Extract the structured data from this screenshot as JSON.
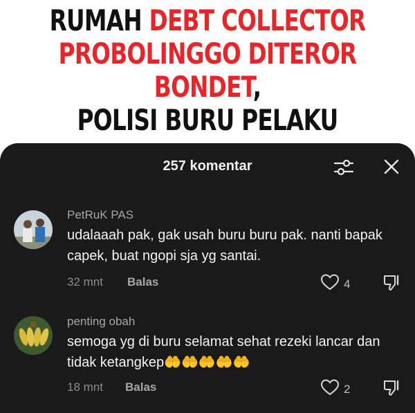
{
  "headline": {
    "line1_black": "RUMAH ",
    "line1_red": "DEBT COLLECTOR",
    "line2_red": "PROBOLINGGO DITEROR BONDET",
    "line2_black": ",",
    "line3_black": "POLISI BURU PELAKU"
  },
  "sheet": {
    "title": "257 komentar",
    "filter_icon": "filter-sliders-icon",
    "close_icon": "close-icon"
  },
  "comments": [
    {
      "username": "PetRuK PAS",
      "text": "udalaaah pak, gak usah buru buru pak. nanti bapak capek, buat ngopi sja yg santai.",
      "time": "32 mnt",
      "reply_label": "Balas",
      "likes": "4"
    },
    {
      "username": "penting obah",
      "text": "semoga yg di buru selamat sehat rezeki lancar dan tidak ketangkep",
      "emojis": "🤲🤲🤲🤲🤲",
      "time": "18 mnt",
      "reply_label": "Balas",
      "likes": "2"
    }
  ],
  "colors": {
    "headline_red": "#e5262b",
    "sheet_background": "#1a1a1a"
  }
}
